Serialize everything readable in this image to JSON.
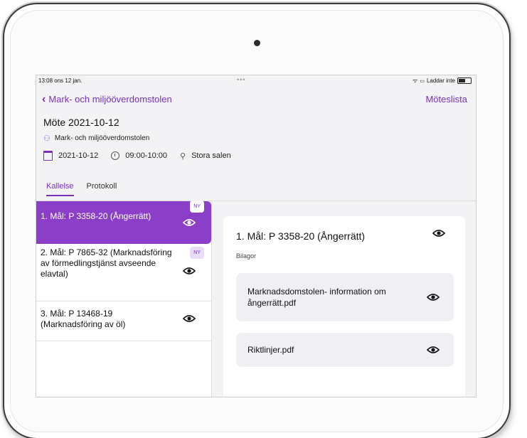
{
  "status": {
    "time_date": "13:08  ons 12 jan.",
    "dots": "•••",
    "charging": "Laddar inte"
  },
  "nav": {
    "back_label": "Mark- och miljööverdomstolen",
    "right_label": "Möteslista"
  },
  "meeting": {
    "title": "Möte 2021-10-12",
    "org": "Mark- och miljööverdomstolen",
    "date": "2021-10-12",
    "time": "09:00-10:00",
    "room": "Stora salen"
  },
  "tabs": [
    "Kallelse",
    "Protokoll"
  ],
  "agenda": [
    {
      "text": "1. Mål: P 3358-20 (Ångerrätt)",
      "badge": "NY"
    },
    {
      "text": "2. Mål: P 7865-32 (Marknadsföring av förmedlingstjänst avseende elavtal)",
      "badge": "NY"
    },
    {
      "text": "3. Mål: P 13468-19 (Marknadsföring av öl)",
      "badge": ""
    }
  ],
  "detail": {
    "title": "1. Mål: P 3358-20 (Ångerrätt)",
    "attachments_label": "Bilagor",
    "files": [
      "Marknadsdomstolen- information om ångerrätt.pdf",
      "Riktlinjer.pdf"
    ]
  },
  "colors": {
    "accent": "#7b2fc0",
    "selected_bg": "#8b3fc9",
    "badge_bg": "#e8dcf7"
  }
}
